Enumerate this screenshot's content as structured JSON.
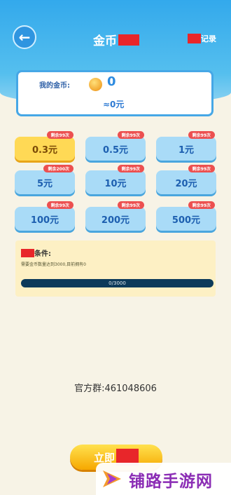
{
  "header": {
    "title": "金币",
    "record_label": "记录"
  },
  "balance": {
    "label": "我的金币:",
    "coins": "0",
    "approx": "≈0元"
  },
  "options": [
    {
      "value": "0.3元",
      "badge": "剩余99次",
      "selected": true
    },
    {
      "value": "0.5元",
      "badge": "剩余99次",
      "selected": false
    },
    {
      "value": "1元",
      "badge": "剩余99次",
      "selected": false
    },
    {
      "value": "5元",
      "badge": "剩余200次",
      "selected": false
    },
    {
      "value": "10元",
      "badge": "剩余99次",
      "selected": false
    },
    {
      "value": "20元",
      "badge": "剩余99次",
      "selected": false
    },
    {
      "value": "100元",
      "badge": "剩余99次",
      "selected": false
    },
    {
      "value": "200元",
      "badge": "剩余99次",
      "selected": false
    },
    {
      "value": "500元",
      "badge": "剩余99次",
      "selected": false
    }
  ],
  "condition": {
    "title": "条件:",
    "desc": "需要金币数量达到3000,目前拥有0",
    "progress_text": "0/3000",
    "progress": 0
  },
  "group": "官方群:461048606",
  "claim_button": "立即",
  "watermark": "铺路手游网",
  "colors": {
    "accent": "#33a9ec",
    "selected_option": "#ffd955",
    "badge": "#ec5050",
    "redaction": "#e8262a"
  }
}
